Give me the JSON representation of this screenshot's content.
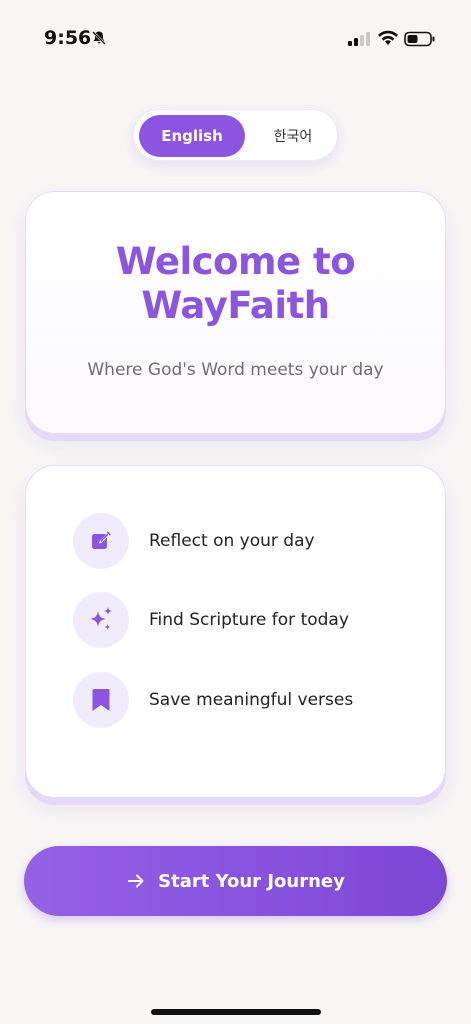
{
  "status_bar": {
    "time": "9:56",
    "icons": [
      "bell-slash-icon",
      "signal-icon",
      "wifi-icon",
      "battery-icon"
    ]
  },
  "language_toggle": {
    "options": [
      {
        "label": "English",
        "selected": true
      },
      {
        "label": "한국어",
        "selected": false
      }
    ]
  },
  "welcome": {
    "title_line1": "Welcome to",
    "title_line2": "WayFaith",
    "subtitle": "Where God's Word meets your day"
  },
  "features": [
    {
      "icon": "edit-note-icon",
      "label": "Reflect on your day"
    },
    {
      "icon": "sparkles-icon",
      "label": "Find Scripture for today"
    },
    {
      "icon": "bookmark-icon",
      "label": "Save meaningful verses"
    }
  ],
  "cta": {
    "icon": "arrow-right-icon",
    "label": "Start Your Journey"
  },
  "colors": {
    "accent": "#8b55e0",
    "background": "#f8f6f5",
    "icon_bg": "#f1ecfb"
  }
}
